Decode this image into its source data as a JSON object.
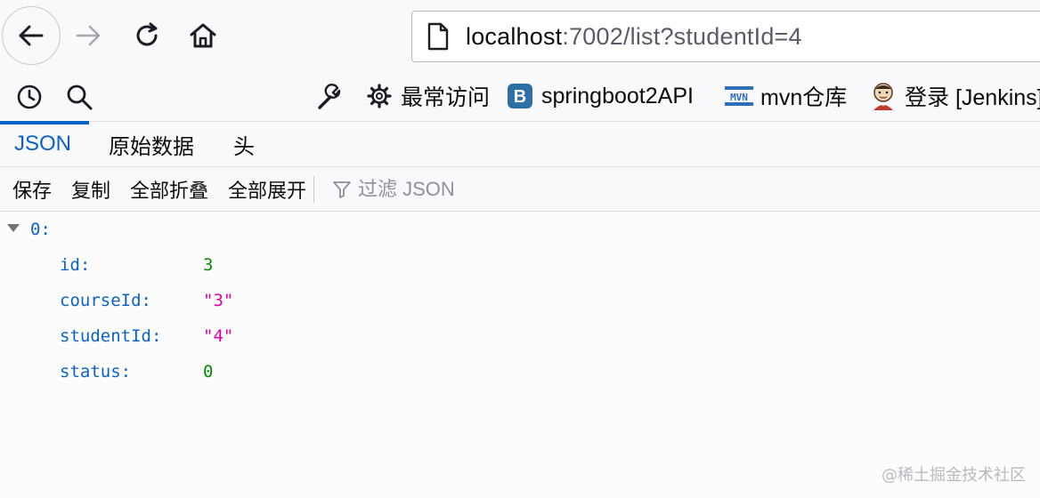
{
  "navbar": {
    "url_host": "localhost",
    "url_rest": ":7002/list?studentId=4"
  },
  "bookmarks": [
    {
      "label": "最常访问",
      "icon": "gear-icon"
    },
    {
      "label": "springboot2API",
      "icon": "bootstrap-icon"
    },
    {
      "label": "mvn仓库",
      "icon": "mvn-icon"
    },
    {
      "label": "登录 [Jenkins]",
      "icon": "jenkins-icon"
    }
  ],
  "tabs": [
    "JSON",
    "原始数据",
    "头"
  ],
  "json_toolbar": {
    "save": "保存",
    "copy": "复制",
    "collapse_all": "全部折叠",
    "expand_all": "全部展开",
    "filter_placeholder": "过滤 JSON"
  },
  "json": {
    "index": "0:",
    "fields": [
      {
        "key": "id:",
        "value": "3",
        "type": "number"
      },
      {
        "key": "courseId:",
        "value": "\"3\"",
        "type": "string"
      },
      {
        "key": "studentId:",
        "value": "\"4\"",
        "type": "string"
      },
      {
        "key": "status:",
        "value": "0",
        "type": "number"
      }
    ]
  },
  "watermark": "@稀土掘金技术社区",
  "colors": {
    "accent": "#0a62c9",
    "key": "#0a62c9",
    "number": "#058b00",
    "string": "#dd00a9"
  }
}
